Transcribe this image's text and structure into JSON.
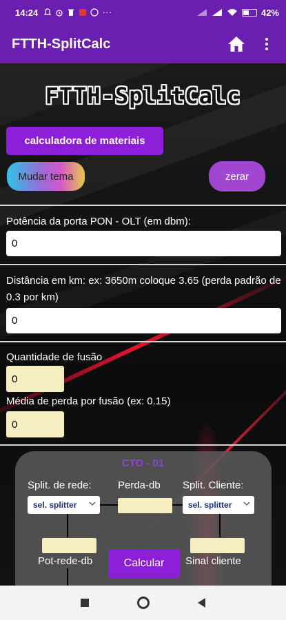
{
  "status_bar": {
    "time": "14:24",
    "battery": "42%"
  },
  "app_bar": {
    "title": "FTTH-SplitCalc"
  },
  "header": {
    "logo_title": "FTTH-SplitCalc"
  },
  "buttons": {
    "materials": "calculadora de materiais",
    "theme": "Mudar tema",
    "reset": "zerar",
    "calculate": "Calcular"
  },
  "fields": {
    "pon_power": {
      "label": "Potência da porta PON - OLT (em dbm):",
      "value": "0"
    },
    "distance": {
      "label": "Distância em km: ex: 3650m coloque 3.65 (perda padrão de 0.3 por km)",
      "value": "0"
    },
    "fusion_qty": {
      "label": "Quantidade de fusão",
      "value": "0"
    },
    "fusion_loss": {
      "label": "Média de perda por fusão (ex: 0.15)",
      "value": "0"
    }
  },
  "cto": {
    "title": "CTO - 01",
    "split_network_label": "Split. de rede:",
    "loss_label": "Perda-db",
    "split_client_label": "Split. Cliente:",
    "split_network_select": "sel. splitter",
    "split_client_select": "sel. splitter",
    "network_power_label": "Pot-rede-db",
    "client_signal_label": "Sinal cliente"
  },
  "colors": {
    "accent": "#6a1fb0",
    "button": "#8e1fd9",
    "input_yellow": "#f5eec0"
  }
}
